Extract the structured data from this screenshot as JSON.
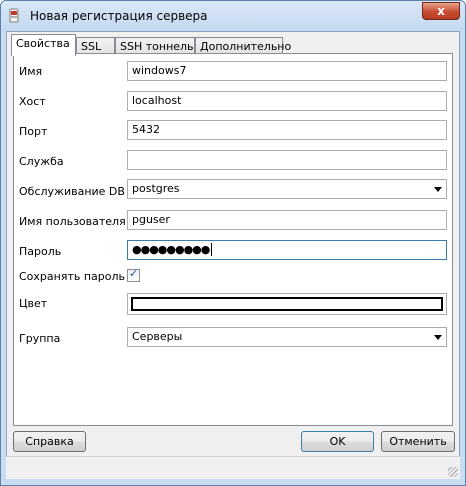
{
  "window": {
    "title": "Новая регистрация сервера",
    "close_glyph": "x",
    "app_icon": "elephant-icon"
  },
  "tabs": [
    {
      "label": "Свойства",
      "active": true
    },
    {
      "label": "SSL",
      "active": false
    },
    {
      "label": "SSH тоннель",
      "active": false
    },
    {
      "label": "Дополнительно",
      "active": false
    }
  ],
  "form": {
    "name": {
      "label": "Имя",
      "value": "windows7"
    },
    "host": {
      "label": "Хост",
      "value": "localhost"
    },
    "port": {
      "label": "Порт",
      "value": "5432"
    },
    "service": {
      "label": "Служба",
      "value": ""
    },
    "maintenance_db": {
      "label": "Обслуживание DB",
      "value": "postgres"
    },
    "username": {
      "label": "Имя пользователя",
      "value": "pguser"
    },
    "password": {
      "label": "Пароль",
      "value": "●●●●●●●●●"
    },
    "store_password": {
      "label": "Сохранять пароль",
      "checked": true,
      "check_glyph": "✓"
    },
    "color": {
      "label": "Цвет",
      "value": "#ffffff"
    },
    "group": {
      "label": "Группа",
      "value": "Серверы"
    }
  },
  "buttons": {
    "help": "Справка",
    "ok": "OK",
    "cancel": "Отменить"
  },
  "colors": {
    "titlebar": "#c9dcf1",
    "close": "#c74e32",
    "check": "#1d5197"
  }
}
